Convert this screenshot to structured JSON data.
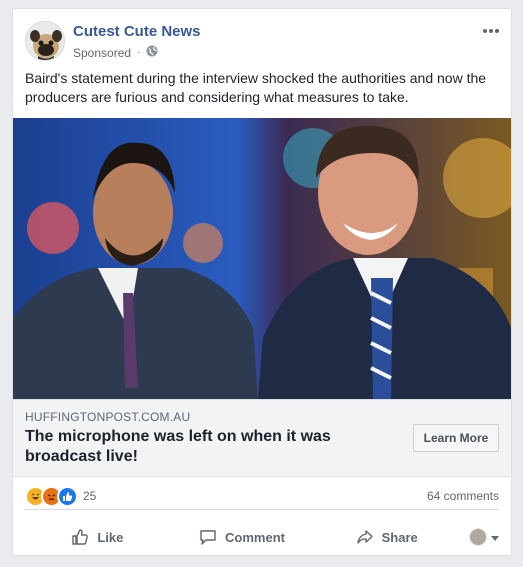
{
  "post": {
    "page_name": "Cutest Cute News",
    "sponsored_label": "Sponsored",
    "text": "Baird's statement during the interview shocked the authorities and now the producers are furious and considering what measures to take."
  },
  "link_preview": {
    "domain": "HUFFINGTONPOST.COM.AU",
    "headline": "The microphone was left on when it was broadcast live!",
    "cta_label": "Learn More"
  },
  "engagement": {
    "reaction_icons": [
      "haha-icon",
      "angry-icon",
      "like-icon"
    ],
    "reaction_count": "25",
    "comment_count": "64 comments"
  },
  "actions": {
    "like_label": "Like",
    "comment_label": "Comment",
    "share_label": "Share"
  },
  "colors": {
    "page_name": "#385898",
    "background": "#e9ebee",
    "secondary_text": "#606770",
    "like_blue": "#1877f2",
    "haha_yellow": "#f7b125",
    "angry_red": "#e9710f"
  }
}
